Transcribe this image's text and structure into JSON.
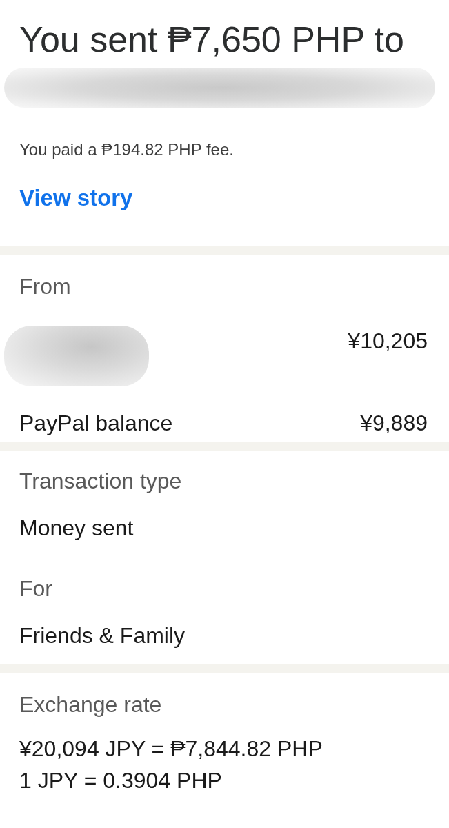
{
  "header": {
    "title": "You sent ₱7,650 PHP to",
    "recipient_redacted": true,
    "fee_note": "You paid a ₱194.82 PHP fee.",
    "link": "View story"
  },
  "from": {
    "label": "From",
    "rows": [
      {
        "kind": "redacted",
        "amount": "¥10,205"
      },
      {
        "kind": "text",
        "name": "PayPal balance",
        "amount": "¥9,889"
      }
    ]
  },
  "details": [
    {
      "label": "Transaction type",
      "value": "Money sent"
    },
    {
      "label": "For",
      "value": "Friends & Family"
    }
  ],
  "exchange": {
    "label": "Exchange rate",
    "lines": [
      "¥20,094 JPY = ₱7,844.82 PHP",
      "1 JPY = 0.3904 PHP"
    ]
  }
}
